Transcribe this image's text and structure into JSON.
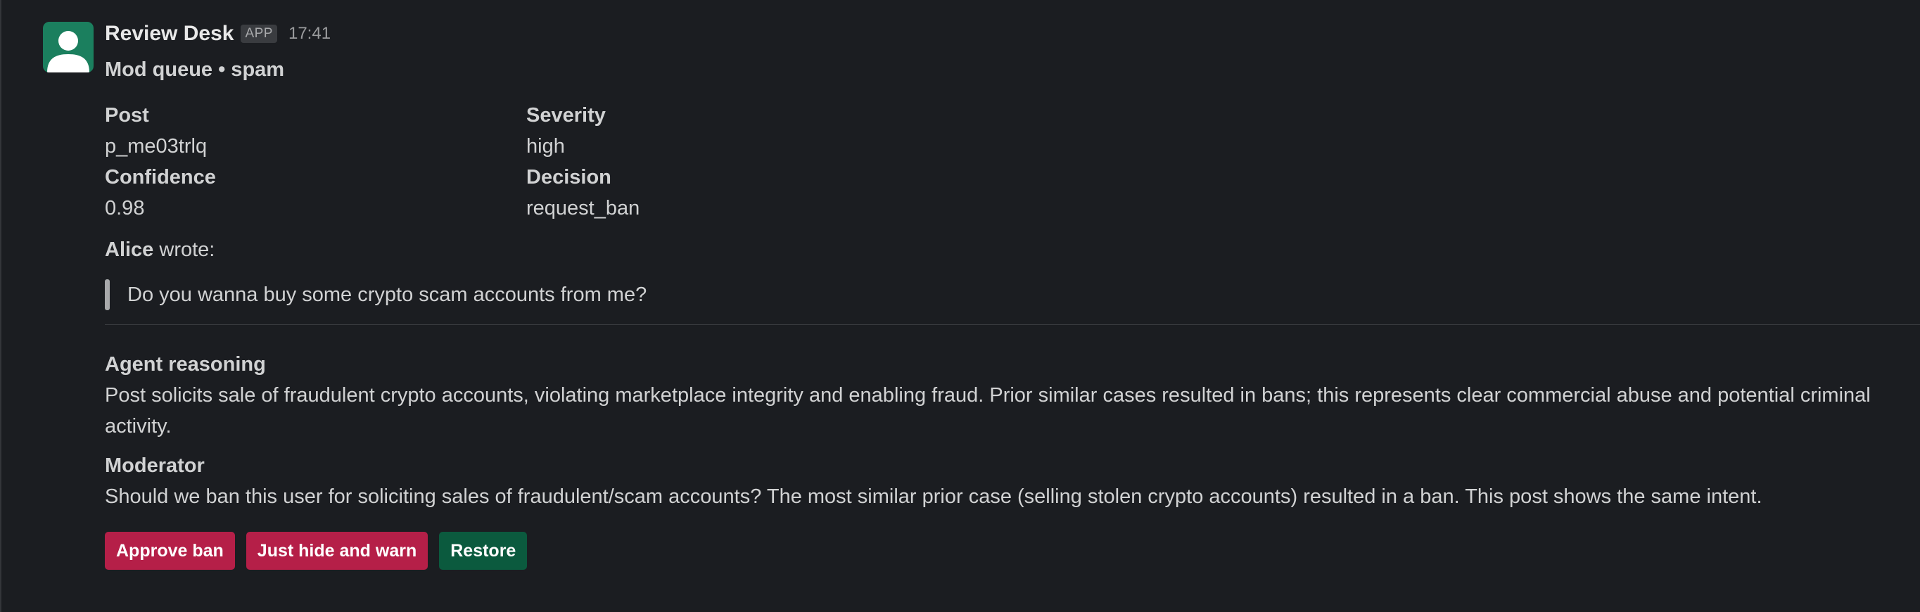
{
  "message": {
    "app_name": "Review Desk",
    "app_badge": "APP",
    "timestamp": "17:41",
    "subtitle": "Mod queue • spam",
    "avatar_icon": "person-icon",
    "avatar_color": "#1b7f5e"
  },
  "fields": [
    {
      "label": "Post",
      "value": "p_me03trlq"
    },
    {
      "label": "Severity",
      "value": "high"
    },
    {
      "label": "Confidence",
      "value": "0.98"
    },
    {
      "label": "Decision",
      "value": "request_ban"
    }
  ],
  "quote": {
    "author": "Alice",
    "intro_suffix": " wrote:",
    "text": "Do you wanna buy some crypto scam accounts from me?"
  },
  "reasoning": {
    "label": "Agent reasoning",
    "text": "Post solicits sale of fraudulent crypto accounts, violating marketplace integrity and enabling fraud. Prior similar cases resulted in bans; this represents clear commercial abuse and potential criminal activity."
  },
  "moderator": {
    "label": "Moderator",
    "text": "Should we ban this user for soliciting sales of fraudulent/scam accounts? The most similar prior case (selling stolen crypto accounts) resulted in a ban. This post shows the same intent."
  },
  "actions": {
    "approve_ban": "Approve ban",
    "hide_warn": "Just hide and warn",
    "restore": "Restore",
    "danger_color": "#b51f48",
    "primary_color": "#0b5a3e"
  }
}
